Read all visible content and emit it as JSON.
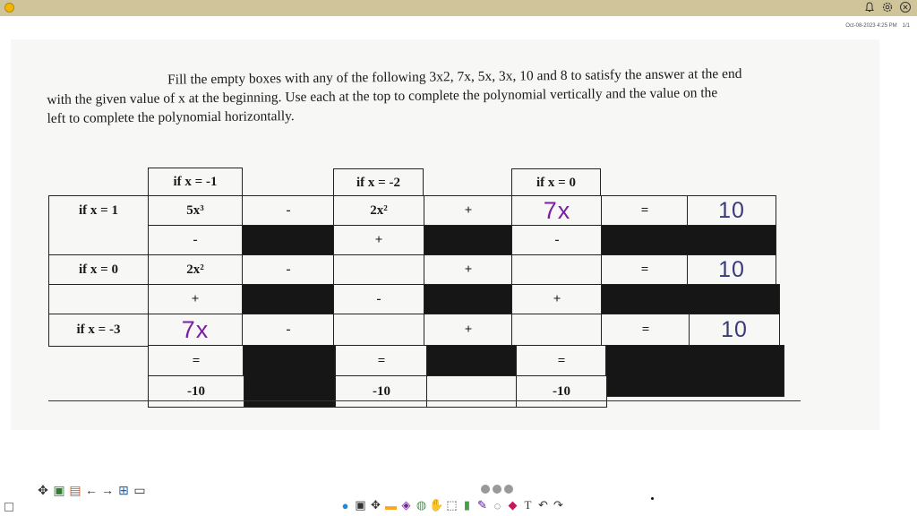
{
  "window": {
    "accent_color": "#cfc49a",
    "top_icons": [
      "bell-icon",
      "gear-icon",
      "close-icon"
    ],
    "timestamp": "Oct-08-2023 4:25 PM",
    "page_indicator": "1/1"
  },
  "document": {
    "instructions": {
      "line1": "Fill the empty boxes with any of the following 3x2, 7x, 5x, 3x, 10 and 8 to satisfy the answer at the end",
      "line2": "with the given value of x at the beginning. Use each at the top to complete the polynomial vertically and the value on the",
      "line3": "left to complete the polynomial horizontally."
    },
    "table": {
      "col_headers": [
        "if x = -1",
        "if x = -2",
        "if x = 0"
      ],
      "row_headers": [
        "if x = 1",
        "if x = 0",
        "if x = -3"
      ],
      "row1": [
        "5x³",
        "-",
        "2x²",
        "+",
        "7x",
        "=",
        "10"
      ],
      "vert1": [
        "-",
        "+",
        "-"
      ],
      "row2": [
        "2x²",
        "-",
        "",
        "+",
        "",
        "=",
        "10"
      ],
      "vert2": [
        "+",
        "-",
        "+"
      ],
      "row3": [
        "7x",
        "-",
        "",
        "+",
        "",
        "=",
        "10"
      ],
      "vert3": [
        "=",
        "=",
        "="
      ],
      "results": [
        "-10",
        "-10",
        "-10"
      ],
      "handwriting_color": "#7b1fa2"
    }
  },
  "toolbars": {
    "left": [
      "move-icon",
      "image-icon",
      "document-icon",
      "arrow-left-icon",
      "arrow-right-icon",
      "add-page-icon",
      "page-icon"
    ],
    "bottom": [
      "people-icon",
      "screenshot-icon",
      "move-icon",
      "folder-icon",
      "layers-icon",
      "globe-icon",
      "hand-icon",
      "select-icon",
      "highlighter-icon",
      "pen-icon",
      "lasso-icon",
      "eraser-icon",
      "text-icon",
      "undo-icon",
      "redo-icon"
    ]
  }
}
